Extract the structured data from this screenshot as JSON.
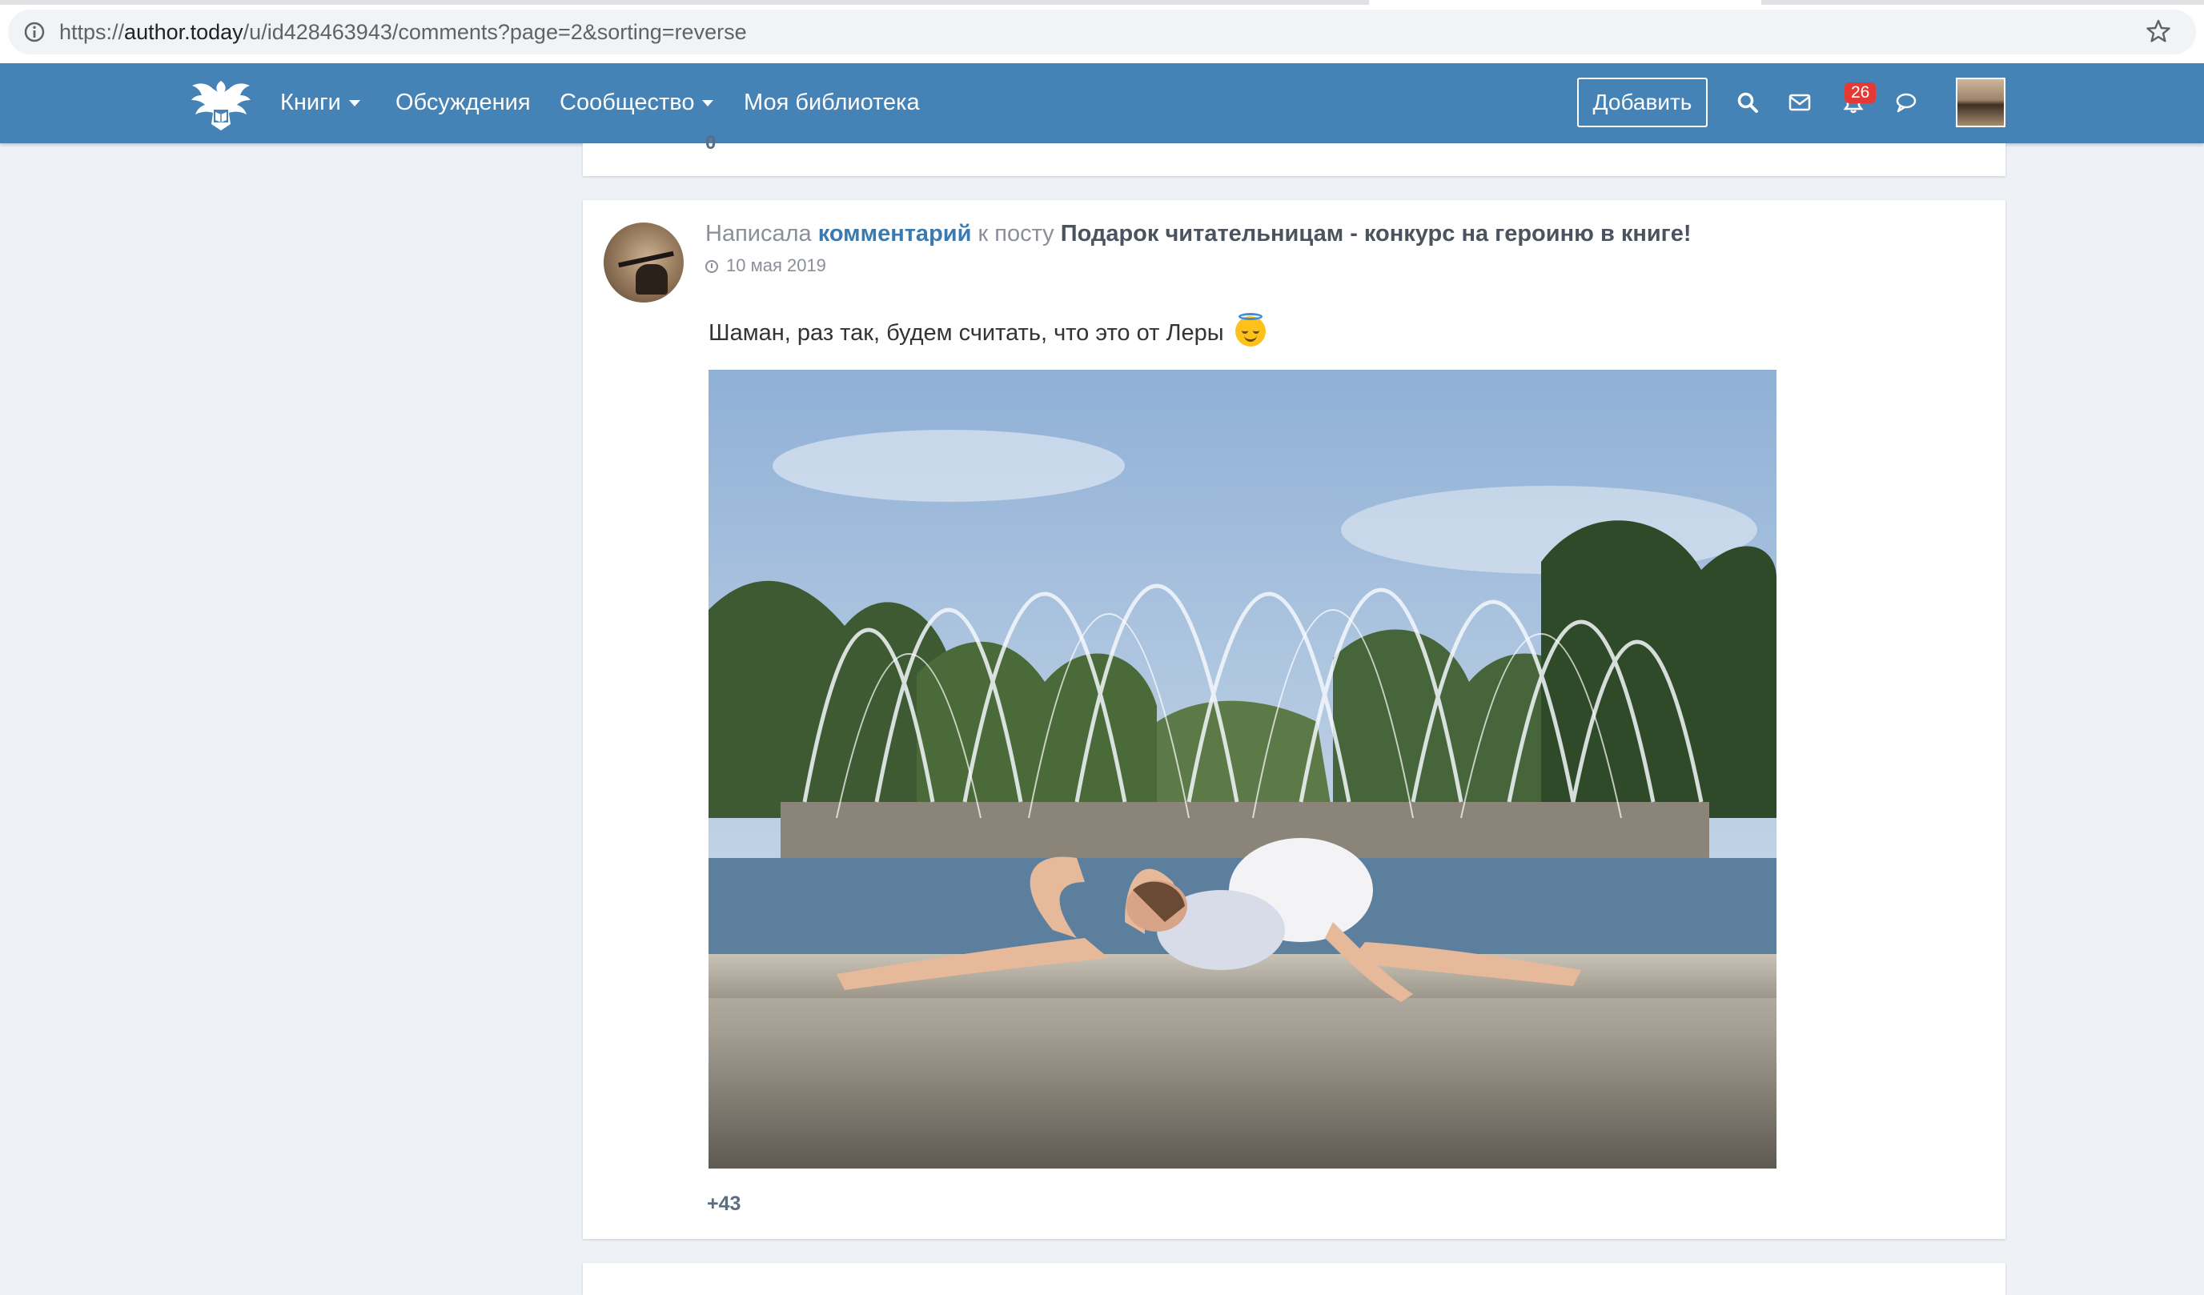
{
  "browser": {
    "url_prefix": "https://",
    "url_host": "author.today",
    "url_path": "/u/id428463943/comments?page=2&sorting=reverse"
  },
  "nav": {
    "books": "Книги",
    "discussions": "Обсуждения",
    "community": "Сообщество",
    "library": "Моя библиотека",
    "add_button": "Добавить",
    "notifications_count": "26"
  },
  "prev_card": {
    "score": "0"
  },
  "comment": {
    "action_prefix": "Написала",
    "action_link": "комментарий",
    "action_middle": "к посту",
    "post_title": "Подарок читательницам - конкурс на героиню в книге!",
    "date": "10 мая 2019",
    "text": "Шаман, раз так, будем считать, что это от Леры",
    "score": "+43"
  },
  "colors": {
    "header": "#4582b5",
    "link": "#3b7ab0",
    "badge": "#e53935",
    "page_bg": "#eef2f7"
  },
  "icons": [
    "info-icon",
    "star-icon",
    "site-logo",
    "search-icon",
    "mail-icon",
    "bell-icon",
    "chat-icon",
    "clock-icon",
    "smiling-face-with-halo"
  ]
}
